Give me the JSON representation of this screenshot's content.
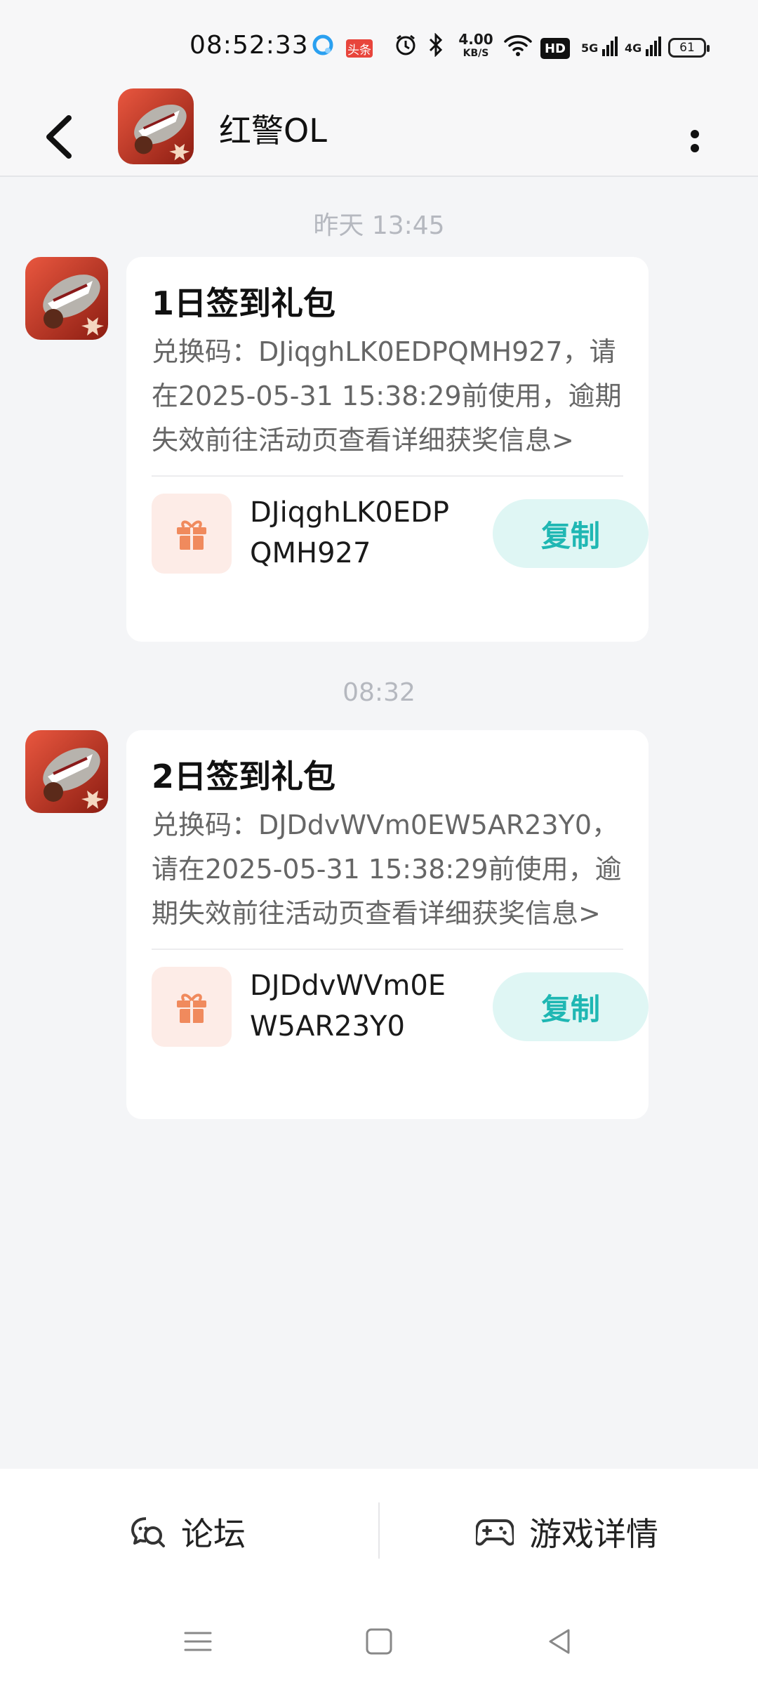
{
  "status_bar": {
    "time": "08:52:33",
    "toutiao_badge": "头条",
    "net_speed_value": "4.00",
    "net_speed_unit": "KB/S",
    "hd_label": "HD",
    "sim1_label": "5G",
    "sim2_label": "4G",
    "battery": "61"
  },
  "header": {
    "title": "红警OL"
  },
  "messages": [
    {
      "timestamp": "昨天 13:45",
      "title": "1日签到礼包",
      "body": "兑换码：DJiqghLK0EDPQMH927，请在2025-05-31 15:38:29前使用，逾期失效前往活动页查看详细获奖信息>",
      "code": "DJiqghLK0EDPQMH927",
      "copy_label": "复制"
    },
    {
      "timestamp": "08:32",
      "title": "2日签到礼包",
      "body": "兑换码：DJDdvWVm0EW5AR23Y0，请在2025-05-31 15:38:29前使用，逾期失效前往活动页查看详细获奖信息>",
      "code": "DJDdvWVm0EW5AR23Y0",
      "copy_label": "复制"
    }
  ],
  "bottom_tabs": [
    {
      "label": "论坛",
      "icon": "forum-chat-icon"
    },
    {
      "label": "游戏详情",
      "icon": "gamepad-icon"
    }
  ],
  "colors": {
    "accent": "#1fb7b3",
    "copy_bg": "#dff6f4",
    "gift_bg": "#fdece7",
    "gift_icon": "#f08a5d"
  }
}
